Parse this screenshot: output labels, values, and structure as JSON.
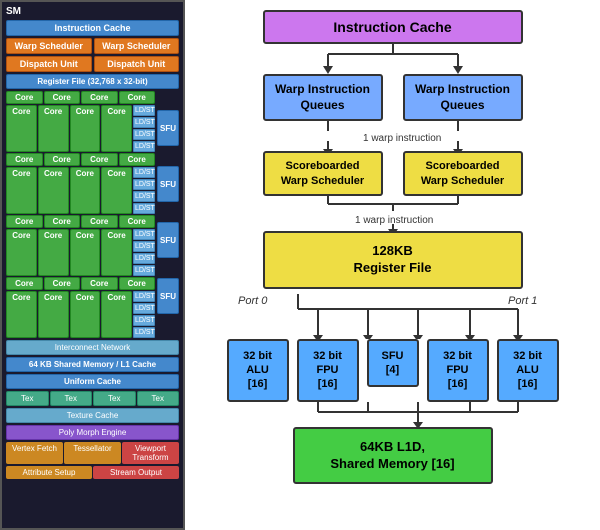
{
  "left": {
    "sm_label": "SM",
    "instr_cache": "Instruction Cache",
    "warp_scheduler_1": "Warp Scheduler",
    "warp_scheduler_2": "Warp Scheduler",
    "dispatch_unit_1": "Dispatch Unit",
    "dispatch_unit_2": "Dispatch Unit",
    "register_file": "Register File (32,768 x 32-bit)",
    "cores": [
      [
        "Core",
        "Core",
        "Core",
        "Core"
      ],
      [
        "Core",
        "Core",
        "Core",
        "Core"
      ],
      [
        "Core",
        "Core",
        "Core",
        "Core"
      ],
      [
        "Core",
        "Core",
        "Core",
        "Core"
      ],
      [
        "Core",
        "Core",
        "Core",
        "Core"
      ],
      [
        "Core",
        "Core",
        "Core",
        "Core"
      ],
      [
        "Core",
        "Core",
        "Core",
        "Core"
      ],
      [
        "Core",
        "Core",
        "Core",
        "Core"
      ]
    ],
    "ldst_label": "LD/ST",
    "sfu_label": "SFU",
    "interconnect": "Interconnect Network",
    "shared_mem": "64 KB Shared Memory / L1 Cache",
    "uniform_cache": "Uniform Cache",
    "tex_units": [
      "Tex",
      "Tex",
      "Tex",
      "Tex"
    ],
    "texture_cache": "Texture Cache",
    "poly_morph": "Poly Morph Engine",
    "vertex_fetch": "Vertex Fetch",
    "tessellator": "Tessellator",
    "viewport": "Viewport Transform",
    "attrib_setup": "Attribute Setup",
    "stream_output": "Stream Output"
  },
  "right": {
    "instr_cache": "Instruction Cache",
    "warp_q_label": "Warp Instruction\nQueues",
    "arrow_label_1": "1 warp instruction",
    "scoreboard_label": "Scoreboarded\nWarp Scheduler",
    "arrow_label_2": "1 warp instruction",
    "regfile_label": "128KB\nRegister File",
    "port_0": "Port 0",
    "port_1": "Port 1",
    "alu_1": "32 bit\nALU\n[16]",
    "fpu_1": "32 bit\nFPU\n[16]",
    "sfu": "SFU\n[4]",
    "fpu_2": "32 bit\nFPU\n[16]",
    "alu_2": "32 bit\nALU\n[16]",
    "shared_mem": "64KB L1D,\nShared Memory [16]"
  }
}
